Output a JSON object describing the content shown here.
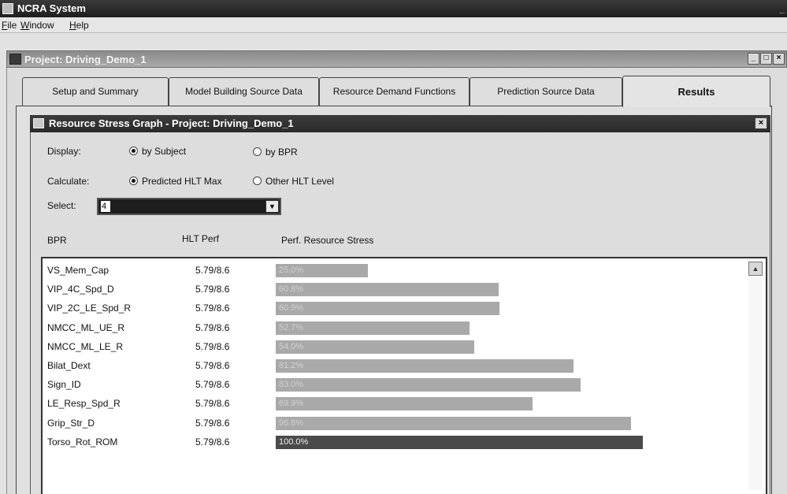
{
  "app": {
    "title": "NCRA System"
  },
  "menu": {
    "file": "File",
    "window": "Window",
    "help": "Help"
  },
  "project_window": {
    "title": "Project: Driving_Demo_1",
    "min": "_",
    "max": "□",
    "close": "×"
  },
  "tabs": [
    {
      "label": "Setup and Summary"
    },
    {
      "label": "Model Building Source Data"
    },
    {
      "label": "Resource Demand Functions"
    },
    {
      "label": "Prediction Source Data"
    },
    {
      "label": "Results",
      "active": true
    }
  ],
  "dialog": {
    "title": "Resource Stress Graph - Project: Driving_Demo_1",
    "close": "×",
    "display_label": "Display:",
    "display_options": [
      {
        "label": "by Subject",
        "checked": true
      },
      {
        "label": "by BPR",
        "checked": false
      }
    ],
    "calculate_label": "Calculate:",
    "calculate_options": [
      {
        "label": "Predicted HLT Max",
        "checked": true
      },
      {
        "label": "Other HLT Level",
        "checked": false
      }
    ],
    "select_label": "Select:",
    "select_value": "4",
    "columns": {
      "bpr": "BPR",
      "hlt": "HLT Perf",
      "stress": "Perf. Resource Stress"
    }
  },
  "rows": [
    {
      "bpr": "VS_Mem_Cap",
      "hlt": "5.79/8.6",
      "stress_label": "25.0%",
      "stress": 25.0
    },
    {
      "bpr": "VIP_4C_Spd_D",
      "hlt": "5.79/8.6",
      "stress_label": "60.8%",
      "stress": 60.8
    },
    {
      "bpr": "VIP_2C_LE_Spd_R",
      "hlt": "5.79/8.6",
      "stress_label": "60.9%",
      "stress": 60.9
    },
    {
      "bpr": "NMCC_ML_UE_R",
      "hlt": "5.79/8.6",
      "stress_label": "52.7%",
      "stress": 52.7
    },
    {
      "bpr": "NMCC_ML_LE_R",
      "hlt": "5.79/8.6",
      "stress_label": "54.0%",
      "stress": 54.0
    },
    {
      "bpr": "Bilat_Dext",
      "hlt": "5.79/8.6",
      "stress_label": "81.2%",
      "stress": 81.2
    },
    {
      "bpr": "Sign_ID",
      "hlt": "5.79/8.6",
      "stress_label": "83.0%",
      "stress": 83.0
    },
    {
      "bpr": "LE_Resp_Spd_R",
      "hlt": "5.79/8.6",
      "stress_label": "69.9%",
      "stress": 69.9
    },
    {
      "bpr": "Grip_Str_D",
      "hlt": "5.79/8.6",
      "stress_label": "96.8%",
      "stress": 96.8
    },
    {
      "bpr": "Torso_Rot_ROM",
      "hlt": "5.79/8.6",
      "stress_label": "100.0%",
      "stress": 100.0,
      "highlight": true
    }
  ],
  "scroll": {
    "up": "▲"
  },
  "colors": {
    "bar": "#a9a9a9",
    "bar_highlight": "#4a4a4a",
    "titlebar": "#2a2a2a"
  }
}
